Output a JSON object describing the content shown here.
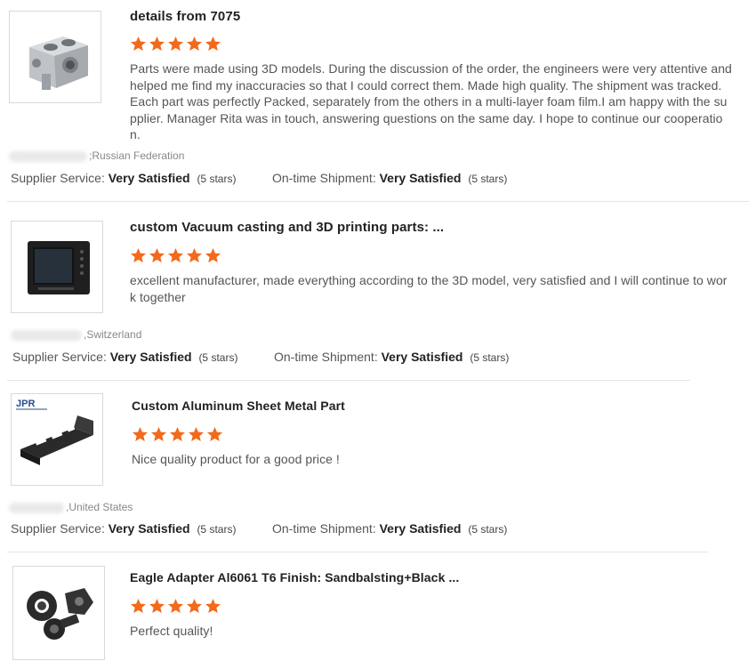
{
  "reviews": [
    {
      "title": "details from 7075",
      "stars": 5,
      "comment": "Parts were made using 3D models. During the discussion of the order, the engineers were very attentive and helped me find my inaccuracies so that I could correct them. Made high quality. The shipment was tracked. Each part was perfectly Packed, separately from the others in a multi-layer foam film.I am happy with the supplier. Manager Rita was in touch, answering questions on the same day. I hope to continue our cooperation.",
      "buyer": ";Russian Federation",
      "supplier_label": "Supplier Service:",
      "supplier_value": "Very Satisfied",
      "supplier_count": "(5 stars)",
      "shipment_label": "On-time Shipment:",
      "shipment_value": "Very Satisfied",
      "shipment_count": "(5 stars)"
    },
    {
      "title": "custom Vacuum casting and 3D printing parts: ...",
      "stars": 5,
      "comment": "excellent manufacturer, made everything according to the 3D model, very satisfied and I will continue to work together",
      "buyer": ",Switzerland",
      "supplier_label": "Supplier Service:",
      "supplier_value": "Very Satisfied",
      "supplier_count": "(5 stars)",
      "shipment_label": "On-time Shipment:",
      "shipment_value": "Very Satisfied",
      "shipment_count": "(5 stars)"
    },
    {
      "title": "Custom Aluminum Sheet Metal Part",
      "stars": 5,
      "comment": "Nice quality product for a good price !",
      "buyer": ",United States",
      "logo_text": "JPR",
      "supplier_label": "Supplier Service:",
      "supplier_value": "Very Satisfied",
      "supplier_count": "(5 stars)",
      "shipment_label": "On-time Shipment:",
      "shipment_value": "Very Satisfied",
      "shipment_count": "(5 stars)"
    },
    {
      "title": "Eagle Adapter Al6061 T6 Finish: Sandbalsting+Black ...",
      "stars": 5,
      "comment": "Perfect quality!"
    }
  ],
  "colors": {
    "star": "#f26a1b",
    "divider": "#e5e5e5"
  }
}
